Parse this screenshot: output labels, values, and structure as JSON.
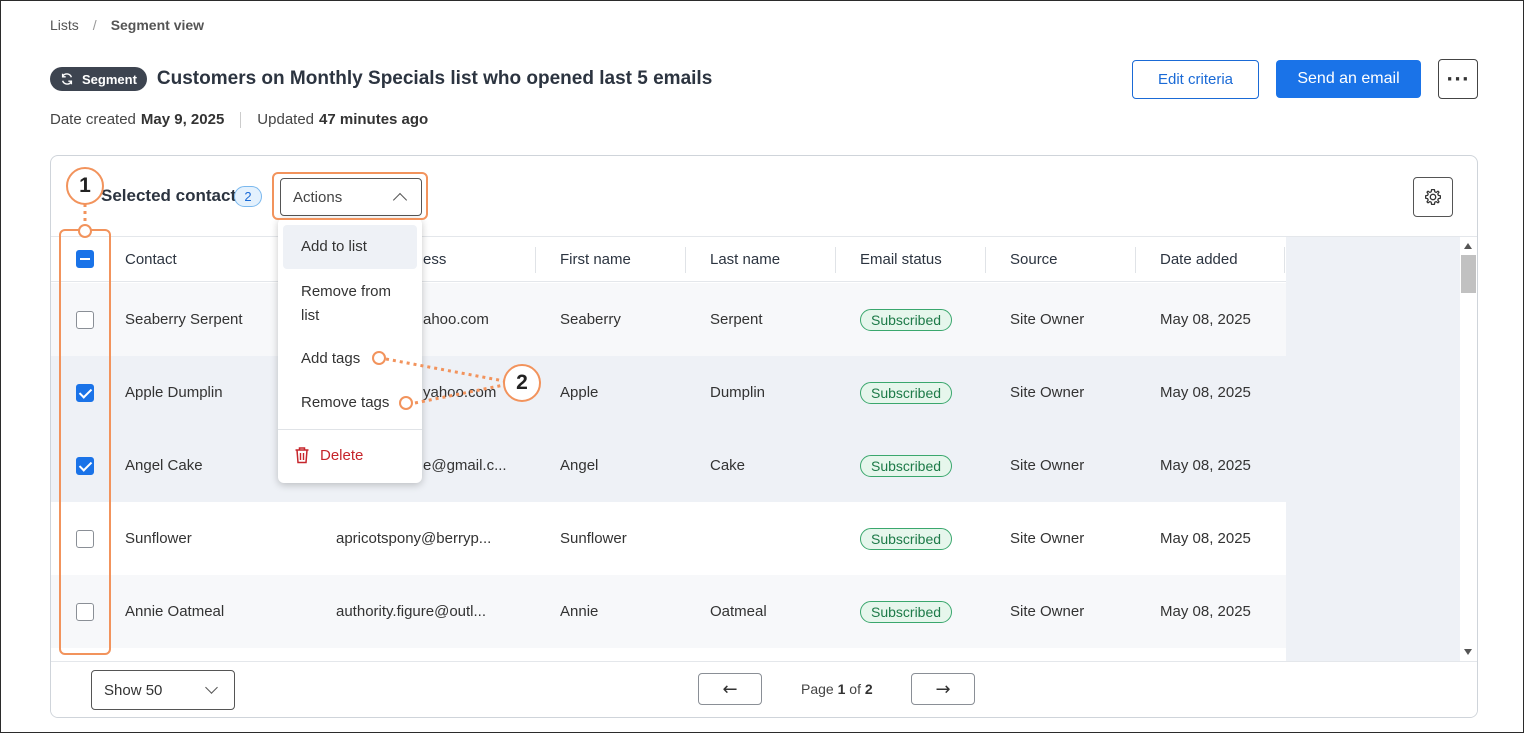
{
  "breadcrumb": {
    "root": "Lists",
    "separator": "/",
    "current": "Segment view"
  },
  "header": {
    "badge": "Segment",
    "title": "Customers on Monthly Specials list who opened last 5 emails",
    "date_created_label": "Date created",
    "date_created": "May 9, 2025",
    "updated_label": "Updated",
    "updated": "47 minutes ago",
    "edit_criteria": "Edit criteria",
    "send_email": "Send an email",
    "more": "···"
  },
  "selection": {
    "label": "Selected contacts",
    "count": "2"
  },
  "actions": {
    "label": "Actions"
  },
  "menu": {
    "add_to_list": "Add to list",
    "remove_from_list_1": "Remove from",
    "remove_from_list_2": "list",
    "add_tags": "Add tags",
    "remove_tags": "Remove tags",
    "delete": "Delete"
  },
  "table": {
    "headers": {
      "contact": "Contact",
      "email": "ess",
      "first": "First name",
      "last": "Last name",
      "status": "Email status",
      "source": "Source",
      "date": "Date added"
    },
    "rows": [
      {
        "contact": "Seaberry Serpent",
        "email": "ahoo.com",
        "first": "Seaberry",
        "last": "Serpent",
        "status": "Subscribed",
        "source": "Site Owner",
        "date": "May 08, 2025",
        "checked": false
      },
      {
        "contact": "Apple Dumplin",
        "email": "yahoo.com",
        "first": "Apple",
        "last": "Dumplin",
        "status": "Subscribed",
        "source": "Site Owner",
        "date": "May 08, 2025",
        "checked": true
      },
      {
        "contact": "Angel Cake",
        "email": "e@gmail.c...",
        "first": "Angel",
        "last": "Cake",
        "status": "Subscribed",
        "source": "Site Owner",
        "date": "May 08, 2025",
        "checked": true
      },
      {
        "contact": "Sunflower",
        "email": "apricotspony@berryp...",
        "first": "Sunflower",
        "last": "",
        "status": "Subscribed",
        "source": "Site Owner",
        "date": "May 08, 2025",
        "checked": false
      },
      {
        "contact": "Annie Oatmeal",
        "email": "authority.figure@outl...",
        "first": "Annie",
        "last": "Oatmeal",
        "status": "Subscribed",
        "source": "Site Owner",
        "date": "May 08, 2025",
        "checked": false
      }
    ]
  },
  "footer": {
    "show": "Show 50",
    "page_label": "Page",
    "page_current": "1",
    "page_of": "of",
    "page_total": "2",
    "prev": "←",
    "next": "→"
  },
  "annotations": {
    "one": "1",
    "two": "2"
  },
  "colors": {
    "accent": "#1a73e8",
    "annotation": "#f2935c",
    "subscribed": "#3aa76d",
    "danger": "#c6252b"
  },
  "icons": [
    "refresh-icon",
    "gear-icon",
    "chevron-up-icon",
    "chevron-down-icon",
    "trash-icon",
    "arrow-left-icon",
    "arrow-right-icon"
  ]
}
